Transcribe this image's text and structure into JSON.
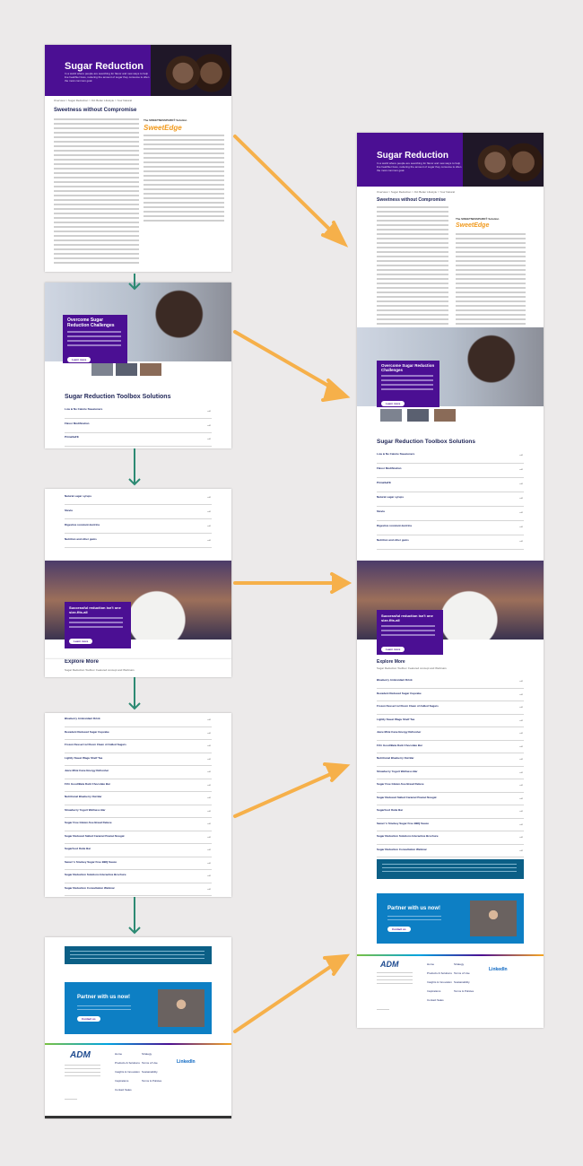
{
  "page": {
    "hero": {
      "title": "Sugar Reduction",
      "subtitle": "In a world where people are searching for flavor and new ways to help live healthier lives, reducing the amount of sugar they consume is often the most common goal."
    },
    "breadcrumb": "Overview > Sugar Reduction > Oct Better Lifestyle > Your Natural",
    "intro": {
      "heading": "Sweetness without Compromise",
      "callout_title": "The SWEETNESSPARK® Solution",
      "brand": "SweetEdge"
    },
    "challenges_cta": {
      "title": "Overcome Sugar Reduction Challenges",
      "button": "Learn more"
    },
    "toolbox": {
      "heading": "Sugar Reduction Toolbox Solutions",
      "items": [
        {
          "title": "Low & No Calorie Sweeteners"
        },
        {
          "title": "Flavor Modification"
        },
        {
          "title": "PrimaSaFE"
        },
        {
          "title": "Natural sugar syrups"
        },
        {
          "title": "Stevia"
        },
        {
          "title": "Digestive resistant dextrins"
        },
        {
          "title": "Nutrition and other gums"
        }
      ]
    },
    "celebration_cta": {
      "title": "Successful reduction isn't one size-fits-all",
      "button": "Learn more"
    },
    "explore": {
      "heading": "Explore More",
      "subtitle": "Sugar Reduction Toolbox: Featured concept and Webinars",
      "items": [
        {
          "title": "Blueberry Antioxidant Drink"
        },
        {
          "title": "Decadent Reduced Sugar Cupcake"
        },
        {
          "title": "Frozen Dessert w/ Room Clean of Added Sugars"
        },
        {
          "title": "Lightly Sweet Wagu Shelf Tea"
        },
        {
          "title": "Juice Mimi Cane Energy Refresher"
        },
        {
          "title": "Fit'n Good/Beta Dark Chocolate Bar"
        },
        {
          "title": "Nutritional Blueberry Oat Bar"
        },
        {
          "title": "Strawberry Yogurt Wellness Bar"
        },
        {
          "title": "Sugar Free Gluten-free Bread Deluxe"
        },
        {
          "title": "Sugar Reduced Salted Caramel Peanut Nougat"
        },
        {
          "title": "Sugarfood Oatie Bar"
        },
        {
          "title": "Sweet 'n Smokey Sugar Free BBQ Sauce"
        },
        {
          "title": "Sugar Reduction Solutions Interactive Brochure"
        },
        {
          "title": "Sugar Reduction Consultation Webinar"
        }
      ]
    },
    "partner": {
      "title": "Partner with us now!",
      "button": "Contact us"
    },
    "footer": {
      "logo": "ADM",
      "col1_title": "Home",
      "col1": [
        "Products & Solutions",
        "Insights & Innovation",
        "Inspirations",
        "Contact Sales"
      ],
      "col2_title": "Strategy",
      "col2": [
        "Terms of Use",
        "Sustainability",
        "Terms & Policies"
      ],
      "linkedin": "LinkedIn"
    }
  }
}
